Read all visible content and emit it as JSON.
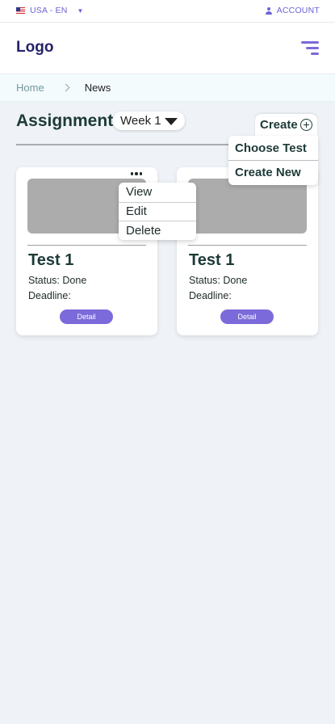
{
  "topbar": {
    "locale_label": "USA - EN",
    "locale_caret": "▼",
    "account_label": "ACCOUNT"
  },
  "header": {
    "logo_text": "Logo"
  },
  "breadcrumb": {
    "home": "Home",
    "current": "News"
  },
  "page": {
    "title": "Assignment",
    "week_selected": "Week 1"
  },
  "create": {
    "button_label": "Create",
    "menu_items": [
      "Choose Test",
      "Create New"
    ]
  },
  "context_menu": {
    "items": [
      "View",
      "Edit",
      "Delete"
    ]
  },
  "cards": [
    {
      "title": "Test 1",
      "status": "Status: Done",
      "deadline": "Deadline:",
      "button": "Detail"
    },
    {
      "title": "Test 1",
      "status": "Status: Done",
      "deadline": "Deadline:",
      "button": "Detail"
    }
  ],
  "colors": {
    "accent": "#7b6ad9",
    "link": "#6b63d6",
    "heading": "#1d3a38",
    "logo": "#25226b",
    "background": "#eff3f7"
  },
  "icons": [
    "us-flag-icon",
    "dropdown-caret-icon",
    "user-icon",
    "hamburger-menu-icon",
    "chevron-right-icon",
    "caret-down-icon",
    "plus-circle-icon",
    "more-dots-icon"
  ]
}
